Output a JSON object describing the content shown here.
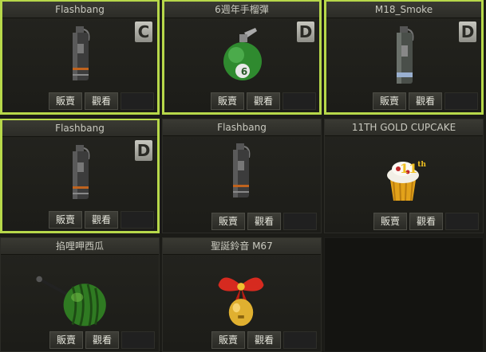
{
  "inventory": {
    "cards": [
      {
        "name": "Flashbang",
        "grade": "C",
        "icon": "flashbang-grenade",
        "selected": true
      },
      {
        "name": "6週年手榴彈",
        "grade": "D",
        "icon": "anniversary-grenade",
        "selected": true
      },
      {
        "name": "M18_Smoke",
        "grade": "D",
        "icon": "smoke-grenade",
        "selected": true
      },
      {
        "name": "Flashbang",
        "grade": "D",
        "icon": "flashbang-grenade",
        "selected": true
      },
      {
        "name": "Flashbang",
        "grade": "",
        "icon": "flashbang-grenade",
        "selected": false
      },
      {
        "name": "11TH GOLD CUPCAKE",
        "grade": "",
        "icon": "gold-cupcake",
        "selected": false
      },
      {
        "name": "掐哩呷西瓜",
        "grade": "",
        "icon": "watermelon-melee",
        "selected": false
      },
      {
        "name": "聖誕鈴音 M67",
        "grade": "",
        "icon": "christmas-bell-grenade",
        "selected": false
      }
    ],
    "sell_label": "販賣",
    "view_label": "觀看",
    "grenade_number": "6",
    "cupcake_number": "11",
    "cupcake_suffix": "th"
  },
  "colors": {
    "selected_border": "#b7d84a",
    "background": "#1b1b17"
  }
}
